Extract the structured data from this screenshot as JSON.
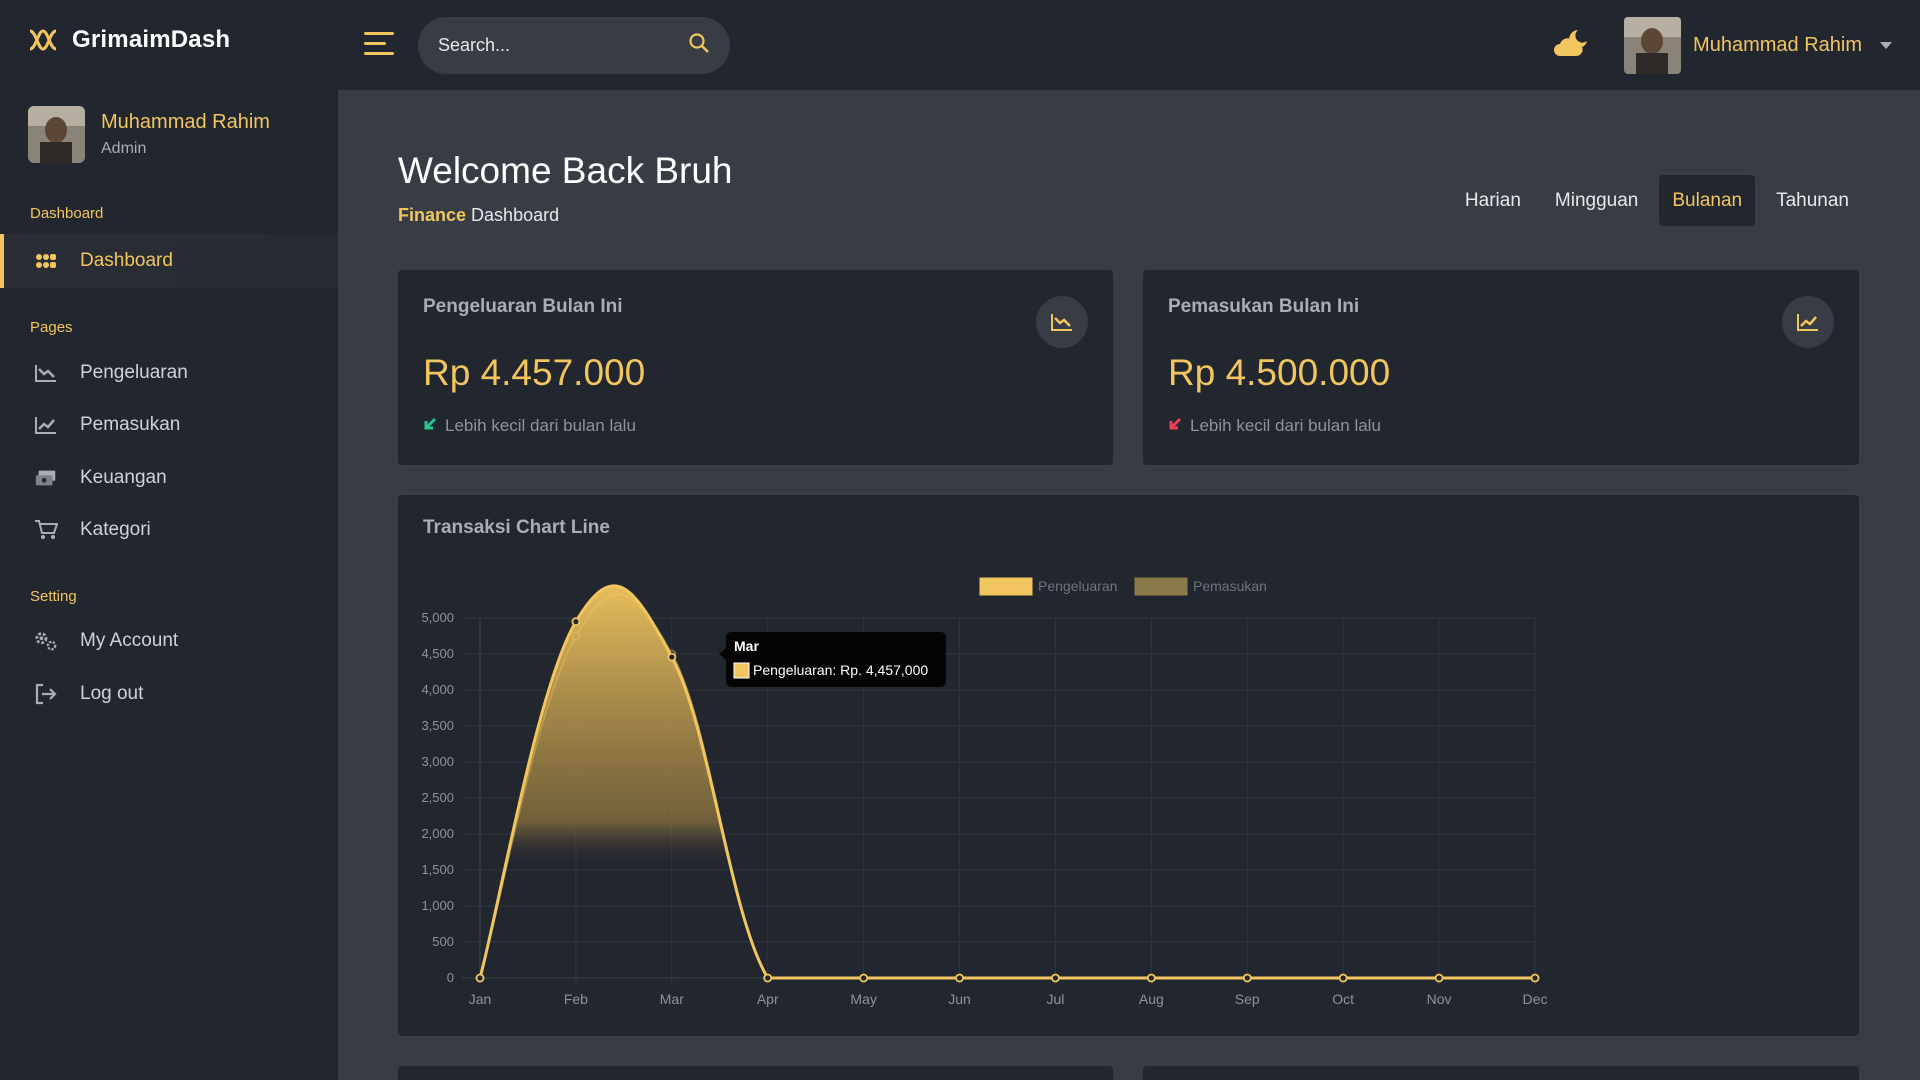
{
  "brand": {
    "name": "GrimaimDash"
  },
  "sidebar": {
    "profile": {
      "name": "Muhammad Rahim",
      "role": "Admin"
    },
    "sections": {
      "dashboard": "Dashboard",
      "pages": "Pages",
      "setting": "Setting"
    },
    "items": [
      {
        "label": "Dashboard",
        "icon": "grid-icon",
        "active": true
      },
      {
        "label": "Pengeluaran",
        "icon": "chart-down-icon"
      },
      {
        "label": "Pemasukan",
        "icon": "chart-up-icon"
      },
      {
        "label": "Keuangan",
        "icon": "money-exchange-icon"
      },
      {
        "label": "Kategori",
        "icon": "cart-icon"
      },
      {
        "label": "My Account",
        "icon": "gears-icon"
      },
      {
        "label": "Log out",
        "icon": "logout-icon"
      }
    ]
  },
  "topbar": {
    "search_placeholder": "Search...",
    "user_name": "Muhammad Rahim"
  },
  "header": {
    "title": "Welcome Back Bruh",
    "subtitle_highlight": "Finance",
    "subtitle_rest": "Dashboard"
  },
  "period_tabs": [
    {
      "label": "Harian"
    },
    {
      "label": "Mingguan"
    },
    {
      "label": "Bulanan",
      "active": true
    },
    {
      "label": "Tahunan"
    }
  ],
  "cards": {
    "expense": {
      "title": "Pengeluaran Bulan Ini",
      "value": "Rp 4.457.000",
      "note": "Lebih kecil dari bulan lalu",
      "note_color": "#2bc48a"
    },
    "income": {
      "title": "Pemasukan Bulan Ini",
      "value": "Rp 4.500.000",
      "note": "Lebih kecil dari bulan lalu",
      "note_color": "#e8415b"
    }
  },
  "colors": {
    "accent": "#f2c65f",
    "sidebar_bg": "#22262e",
    "main_bg": "#383c44"
  },
  "chart_title": "Transaksi Chart Line",
  "chart_data": {
    "type": "line",
    "title": "",
    "categories": [
      "Jan",
      "Feb",
      "Mar",
      "Apr",
      "May",
      "Jun",
      "Jul",
      "Aug",
      "Sep",
      "Oct",
      "Nov",
      "Dec"
    ],
    "series": [
      {
        "name": "Pengeluaran",
        "color": "#f2c65f",
        "values": [
          0,
          4950,
          4457,
          0,
          0,
          0,
          0,
          0,
          0,
          0,
          0,
          0
        ]
      },
      {
        "name": "Pemasukan",
        "color": "#8c7a4a",
        "values": [
          0,
          4750,
          4500,
          0,
          0,
          0,
          0,
          0,
          0,
          0,
          0,
          0
        ]
      }
    ],
    "ylim": [
      0,
      5000
    ],
    "yticks": [
      "0",
      "500",
      "1,000",
      "1,500",
      "2,000",
      "2,500",
      "3,000",
      "3,500",
      "4,000",
      "4,500",
      "5,000"
    ],
    "legend": "top-center",
    "grid": true,
    "tooltip": {
      "title": "Mar",
      "text": "Pengeluaran: Rp. 4,457,000"
    }
  }
}
